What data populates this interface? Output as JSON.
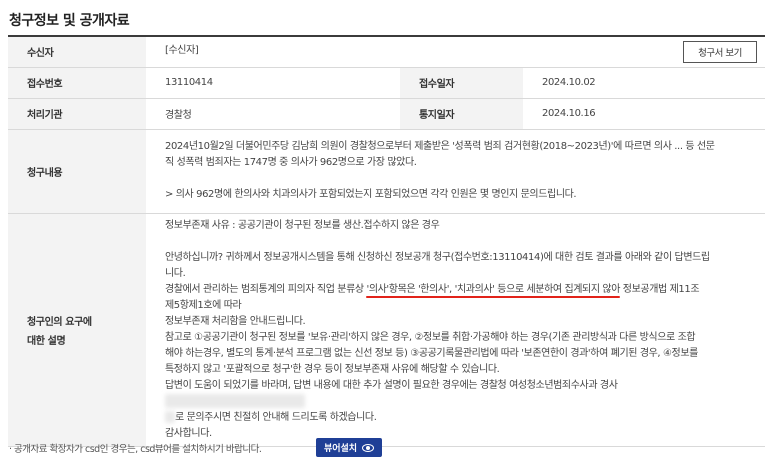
{
  "page_title": "청구정보 및 공개자료",
  "rows": {
    "recipient": {
      "label": "수신자",
      "value": "[수신자]",
      "button": "청구서 보기"
    },
    "receipt_no": {
      "label": "접수번호",
      "value": "13110414",
      "label2": "접수일자",
      "value2": "2024.10.02"
    },
    "agency": {
      "label": "처리기관",
      "value": "경찰청",
      "label2": "통지일자",
      "value2": "2024.10.16"
    },
    "request": {
      "label": "청구내용",
      "line1": "2024년10월2일 더불어민주당 김남희 의원이 경찰청으로부터 제출받은 '성폭력 범죄 검거현황(2018~2023년)'에 따르면 의사 ... 등 선문",
      "line2": "직 성폭력 범죄자는 1747명 중 의사가 962명으로 가장 많았다.",
      "line3": "> 의사 962명에 한의사와 치과의사가 포함되었는지 포함되었으면 각각 인원은 몇 명인지 문의드립니다."
    },
    "explanation": {
      "label_line1": "청구인의 요구에",
      "label_line2": "대한 설명",
      "p1": "정보부존재 사유 : 공공기관이 청구된 정보를 생산.접수하지 않은 경우",
      "p2a": "안녕하십니까? 귀하께서 정보공개시스템을 통해 신청하신 정보공개 청구(접수번호:13110414)에 대한 검토 결과를 아래와 같이 답변드립",
      "p2b": "니다.",
      "p3a_pre": "경찰에서 관리하는 범죄통계의 피의자 직업 분류상 ",
      "p3a_underlined": "'의사'항목은 '한의사', '치과의사' 등으로 세분하여 집계되지 않아",
      "p3a_post": " 정보공개법 제11조",
      "p3b": "제5항제1호에 따라",
      "p3c": "정보부존재 처리함을 안내드립니다.",
      "p4a": "참고로 ①공공기관이 청구된 정보를 '보유·관리'하지 않은 경우, ②정보를 취합·가공해야 하는 경우(기존 관리방식과 다른 방식으로 조합",
      "p4b": "해야 하는경우, 별도의 통계·분석 프로그램 없는 신선 정보 등) ③공공기록물관리법에 따라 '보존연한이 경과'하여 폐기된 경우, ④정보를",
      "p4c": "특정하지 않고 '포괄적으로 청구'한 경우 등이 정보부존재 사유에 해당할 수 있습니다.",
      "p5a": "답변이 도움이 되었기를 바라며, 답변 내용에 대한 추가 설명이 필요한 경우에는 경찰청 여성청소년범죄수사과 경사",
      "p5b": "로 문의주시면 친절히 안내해 드리도록 하겠습니다.",
      "p6": "감사합니다."
    }
  },
  "footer": {
    "note": "· 공개자료 확장자가 csd인 경우는, csd뷰어를 설치하시기 바랍니다.",
    "viewer_button": "뷰어설치",
    "viewer_icon": "eye-icon"
  },
  "colors": {
    "accent_button": "#1f3f96",
    "underline": "#e2231a",
    "header_bg": "#f3f3f3"
  }
}
